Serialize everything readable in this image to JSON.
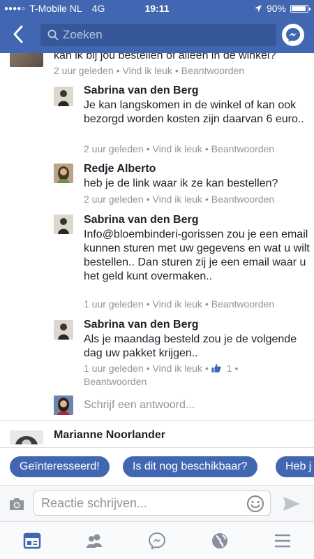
{
  "status_bar": {
    "carrier": "T-Mobile NL",
    "network": "4G",
    "time": "19:11",
    "battery": "90%",
    "battery_level": 0.9
  },
  "header": {
    "search_placeholder": "Zoeken"
  },
  "comments": [
    {
      "text": "kan ik bij jou bestellen of alleen in de winkel?",
      "time": "2 uur geleden",
      "like": "Vind ik leuk",
      "reply": "Beantwoorden"
    },
    {
      "name": "Sabrina van den Berg",
      "text": "Je kan langskomen in de winkel of kan ook bezorgd worden kosten zijn daarvan 6 euro..",
      "time": "2 uur geleden",
      "like": "Vind ik leuk",
      "reply": "Beantwoorden"
    },
    {
      "name": "Redje Alberto",
      "text": "heb je de link waar ik ze kan bestellen?",
      "time": "2 uur geleden",
      "like": "Vind ik leuk",
      "reply": "Beantwoorden"
    },
    {
      "name": "Sabrina van den Berg",
      "text": "Info@bloembinderi-gorissen zou je een email kunnen sturen met uw gegevens en wat u wilt bestellen..  Dan sturen zij je een email waar u het geld kunt overmaken..",
      "time": "1 uur geleden",
      "like": "Vind ik leuk",
      "reply": "Beantwoorden"
    },
    {
      "name": "Sabrina van den Berg",
      "text": "Als je maandag besteld zou je de volgende dag uw pakket krijgen..",
      "time": "1 uur geleden",
      "like": "Vind ik leuk",
      "likes": "1",
      "reply": "Beantwoorden"
    }
  ],
  "reply_placeholder": "Schrijf een antwoord...",
  "next_comment": {
    "name": "Marianne Noorlander"
  },
  "quick_replies": [
    "Geïnteresseerd!",
    "Is dit nog beschikbaar?",
    "Heb j"
  ],
  "composer": {
    "placeholder": "Reactie schrijven..."
  },
  "tabs": [
    "news-feed",
    "friends",
    "messenger",
    "notifications",
    "menu"
  ],
  "colors": {
    "brand": "#4267b2",
    "meta": "#90949c",
    "text": "#1d2129"
  }
}
